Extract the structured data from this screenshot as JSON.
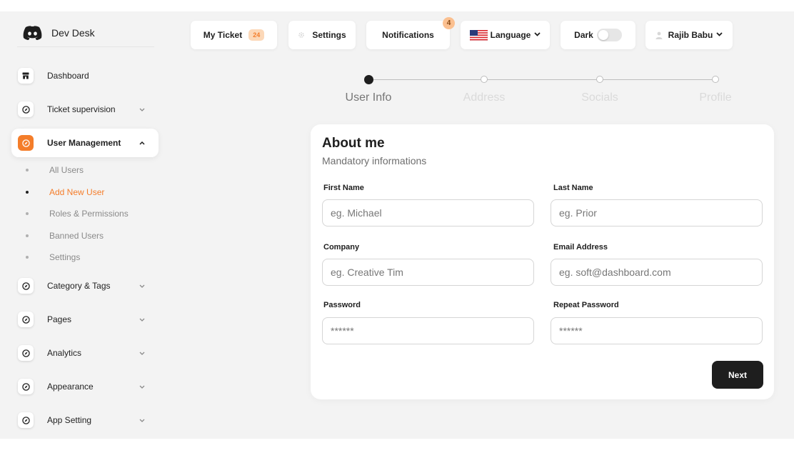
{
  "app": {
    "name": "Dev Desk",
    "logo_icon": "discord-logo"
  },
  "sidebar": {
    "items": [
      {
        "label": "Dashboard",
        "icon": "store-icon",
        "chevron": false,
        "active": false
      },
      {
        "label": "Ticket supervision",
        "icon": "compass-icon",
        "chevron": "down",
        "active": false
      },
      {
        "label": "User Management",
        "icon": "compass-icon",
        "chevron": "up",
        "active": true
      },
      {
        "label": "Category & Tags",
        "icon": "compass-icon",
        "chevron": "down",
        "active": false
      },
      {
        "label": "Pages",
        "icon": "compass-icon",
        "chevron": "down",
        "active": false
      },
      {
        "label": "Analytics",
        "icon": "compass-icon",
        "chevron": "down",
        "active": false
      },
      {
        "label": "Appearance",
        "icon": "compass-icon",
        "chevron": "down",
        "active": false
      },
      {
        "label": "App Setting",
        "icon": "compass-icon",
        "chevron": "down",
        "active": false
      }
    ],
    "user_management_sub": [
      {
        "label": "All Users",
        "active": false
      },
      {
        "label": "Add New User",
        "active": true
      },
      {
        "label": "Roles & Permissions",
        "active": false
      },
      {
        "label": "Banned Users",
        "active": false
      },
      {
        "label": "Settings",
        "active": false
      }
    ]
  },
  "topnav": {
    "my_ticket": {
      "label": "My Ticket",
      "count": "24"
    },
    "settings": {
      "label": "Settings",
      "icon": "gear-icon"
    },
    "notifications": {
      "label": "Notifications",
      "count": "4"
    },
    "language": {
      "label": "Language",
      "icon": "us-flag-icon"
    },
    "dark": {
      "label": "Dark",
      "enabled": false
    },
    "user": {
      "label": "Rajib Babu",
      "icon": "user-icon"
    }
  },
  "stepper": {
    "steps": [
      "User Info",
      "Address",
      "Socials",
      "Profile"
    ],
    "active_index": 0
  },
  "form": {
    "title": "About me",
    "subtitle": "Mandatory informations",
    "fields": {
      "first_name": {
        "label": "First Name",
        "placeholder": "eg. Michael",
        "value": ""
      },
      "last_name": {
        "label": "Last Name",
        "placeholder": "eg. Prior",
        "value": ""
      },
      "company": {
        "label": "Company",
        "placeholder": "eg. Creative Tim",
        "value": ""
      },
      "email": {
        "label": "Email Address",
        "placeholder": "eg. soft@dashboard.com",
        "value": ""
      },
      "password": {
        "label": "Password",
        "placeholder": "******",
        "value": ""
      },
      "repeat_password": {
        "label": "Repeat Password",
        "placeholder": "******",
        "value": ""
      }
    },
    "next_label": "Next"
  },
  "colors": {
    "accent": "#f47d2a",
    "accent_soft": "#fcd8b8",
    "dark": "#1e1e1e",
    "background": "#f3f3f3"
  }
}
